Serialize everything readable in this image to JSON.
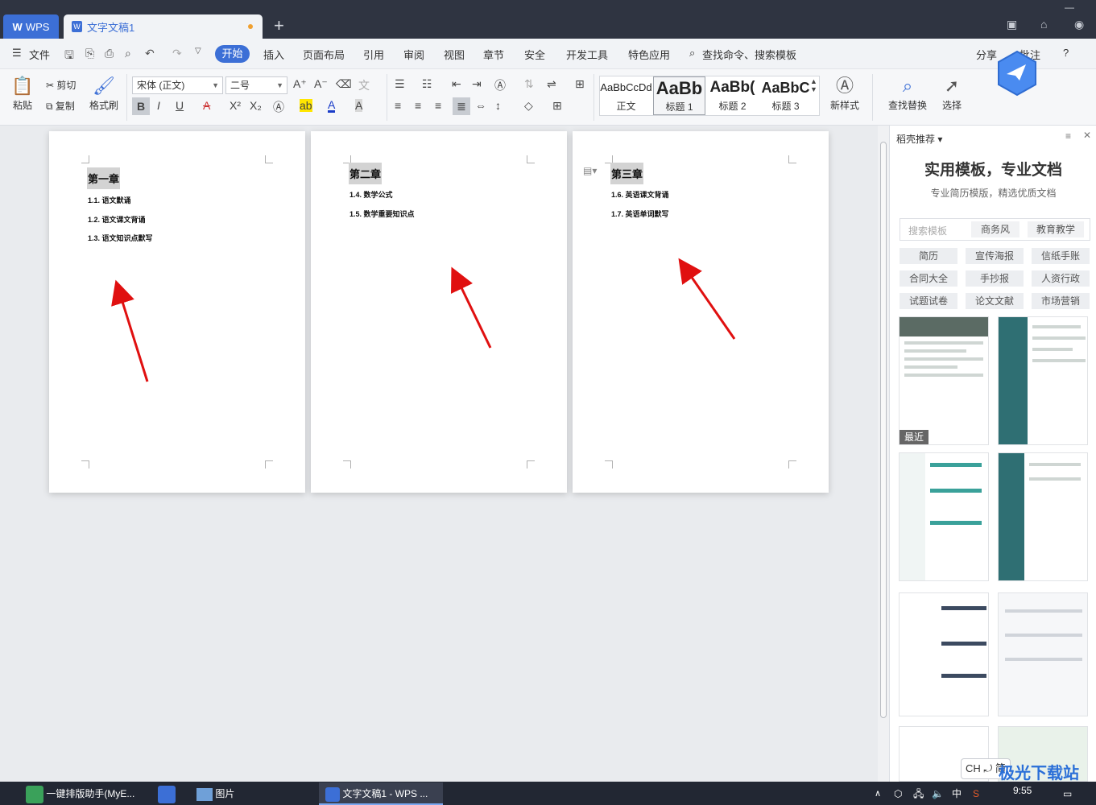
{
  "titlebar": {
    "wps_tab": "WPS",
    "doc_tab": "文字文稿1",
    "new_tab": "+"
  },
  "menubar": {
    "file": "文件",
    "items": [
      "开始",
      "插入",
      "页面布局",
      "引用",
      "审阅",
      "视图",
      "章节",
      "安全",
      "开发工具",
      "特色应用"
    ],
    "search": "查找命令、搜索模板",
    "share": "分享",
    "comment": "批注",
    "help": "?"
  },
  "ribbon": {
    "paste": "粘贴",
    "cut": "剪切",
    "copy": "复制",
    "format_painter": "格式刷",
    "font_name": "宋体 (正文)",
    "font_size": "二号",
    "styles": [
      {
        "preview": "AaBbCcDd",
        "label": "正文"
      },
      {
        "preview": "AaBb",
        "label": "标题 1"
      },
      {
        "preview": "AaBb(",
        "label": "标题 2"
      },
      {
        "preview": "AaBbC",
        "label": "标题 3"
      }
    ],
    "new_style": "新样式",
    "find_replace": "查找替换",
    "select": "选择"
  },
  "pages": [
    {
      "chapter": "第一章",
      "items": [
        "1.1. 语文默诵",
        "1.2. 语文课文背诵",
        "1.3. 语文知识点默写"
      ]
    },
    {
      "chapter": "第二章",
      "items": [
        "1.4. 数学公式",
        "1.5. 数学重要知识点"
      ]
    },
    {
      "chapter": "第三章",
      "items": [
        "1.6. 英语课文背诵",
        "1.7. 英语单词默写"
      ]
    }
  ],
  "sidepanel": {
    "header": "稻壳推荐",
    "title": "实用模板，专业文档",
    "subtitle": "专业简历模版，精选优质文档",
    "search_placeholder": "搜索模板",
    "quick_tags": [
      "商务风",
      "教育教学"
    ],
    "tags": [
      "简历",
      "宣传海报",
      "信纸手账",
      "合同大全",
      "手抄报",
      "人资行政",
      "试题试卷",
      "论文文献",
      "市场营销"
    ],
    "recent_badge": "最近"
  },
  "taskbar": {
    "app1": "一键排版助手(MyE...",
    "app2": "图片",
    "app3": "文字文稿1 - WPS ...",
    "ime": "CH ⤾ 简",
    "time": "9:55",
    "ime_lang": "中",
    "watermark": "极光下载站"
  }
}
